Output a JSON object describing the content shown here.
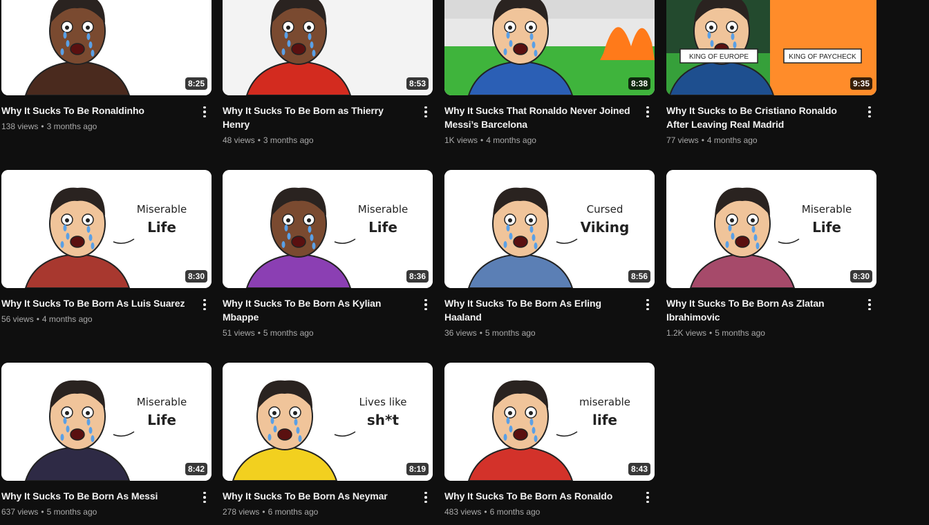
{
  "videos": [
    {
      "title": "Why It Sucks To Be Ronaldinho",
      "views": "138 views",
      "age": "3 months ago",
      "duration": "8:25",
      "bg": "#ffffff",
      "accent": "#4a2a1e",
      "thumb_text": [
        "",
        ""
      ]
    },
    {
      "title": "Why It Sucks To Be Born as Thierry Henry",
      "views": "48 views",
      "age": "3 months ago",
      "duration": "8:53",
      "bg": "#f3f3f3",
      "accent": "#d32b1f",
      "thumb_text": [
        "",
        ""
      ]
    },
    {
      "title": "Why It Sucks That Ronaldo Never Joined Messi’s Barcelona",
      "views": "1K views",
      "age": "4 months ago",
      "duration": "8:38",
      "bg": "#d9d9d9",
      "accent": "#2b5fb5",
      "thumb_text": [
        "",
        ""
      ]
    },
    {
      "title": "Why It Sucks to Be Cristiano Ronaldo After Leaving Real Madrid",
      "views": "77 views",
      "age": "4 months ago",
      "duration": "9:35",
      "bg": "#ff8c2a",
      "accent": "#1e4f8f",
      "thumb_text": [
        "KING OF EUROPE",
        "KING OF PAYCHECK"
      ]
    },
    {
      "title": "Why It Sucks To Be Born As Luis Suarez",
      "views": "56 views",
      "age": "4 months ago",
      "duration": "8:30",
      "bg": "#ffffff",
      "accent": "#a8382f",
      "thumb_text": [
        "Miserable",
        "Life"
      ]
    },
    {
      "title": "Why It Sucks To Be Born As Kylian Mbappe",
      "views": "51 views",
      "age": "5 months ago",
      "duration": "8:36",
      "bg": "#ffffff",
      "accent": "#8b3fb3",
      "thumb_text": [
        "Miserable",
        "Life"
      ]
    },
    {
      "title": "Why It Sucks To Be Born As Erling Haaland",
      "views": "36 views",
      "age": "5 months ago",
      "duration": "8:56",
      "bg": "#ffffff",
      "accent": "#5b7fb5",
      "thumb_text": [
        "Cursed",
        "Viking"
      ]
    },
    {
      "title": "Why It Sucks To Be Born As Zlatan Ibrahimovic",
      "views": "1.2K views",
      "age": "5 months ago",
      "duration": "8:30",
      "bg": "#ffffff",
      "accent": "#a64a6a",
      "thumb_text": [
        "Miserable",
        "Life"
      ]
    },
    {
      "title": "Why It Sucks To Be Born As Messi",
      "views": "637 views",
      "age": "5 months ago",
      "duration": "8:42",
      "bg": "#ffffff",
      "accent": "#2e2a45",
      "thumb_text": [
        "Miserable",
        "Life"
      ]
    },
    {
      "title": "Why It Sucks To Be Born As Neymar",
      "views": "278 views",
      "age": "6 months ago",
      "duration": "8:19",
      "bg": "#ffffff",
      "accent": "#f2d01f",
      "thumb_text": [
        "Lives like",
        "sh*t"
      ]
    },
    {
      "title": "Why It Sucks To Be Born As Ronaldo",
      "views": "483 views",
      "age": "6 months ago",
      "duration": "8:43",
      "bg": "#ffffff",
      "accent": "#d3322a",
      "thumb_text": [
        "miserable",
        "life"
      ]
    }
  ]
}
